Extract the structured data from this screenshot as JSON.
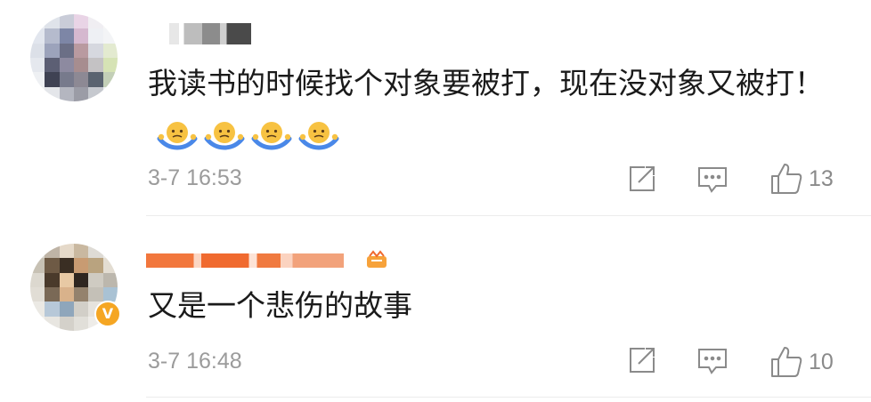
{
  "comments": [
    {
      "text": "我读书的时候找个对象要被打，现在没对象又被打！",
      "emoji_icon": "shrug-emoji",
      "emoji_count": 4,
      "timestamp": "3-7 16:53",
      "likes": "13"
    },
    {
      "text": "又是一个悲伤的故事",
      "timestamp": "3-7 16:48",
      "likes": "10",
      "verified_mark": "V"
    }
  ],
  "icons": {
    "share": "share-icon",
    "comment": "comment-icon",
    "like": "thumbs-up-icon"
  },
  "colors": {
    "text": "#1a1a1a",
    "meta": "#9b9b9b",
    "verified": "#f5a623",
    "emoji": "#f7c242"
  }
}
